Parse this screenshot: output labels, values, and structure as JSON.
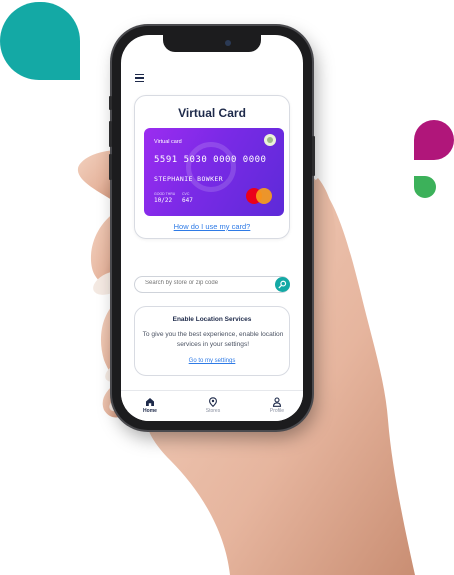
{
  "colors": {
    "teal": "#14a9a5",
    "magenta": "#b0167a",
    "green": "#3cb15a",
    "navy": "#1e2a4a",
    "link": "#2f7be6",
    "card_purple": "#7a2ae6"
  },
  "header": {
    "menu_icon": "hamburger-icon"
  },
  "virtual_card": {
    "title": "Virtual Card",
    "card_label": "Virtual card",
    "card_number": "5591 5030 0000 0000",
    "cardholder": "STEPHANIE BOWKER",
    "expiry_label": "GOOD THRU",
    "expiry": "10/22",
    "cvc_label": "CVC",
    "cvc": "647",
    "network_icon": "mastercard-icon",
    "help_link": "How do I use my card?"
  },
  "search": {
    "placeholder": "Search by store or zip code",
    "button_icon": "search-icon"
  },
  "location_services": {
    "title": "Enable Location Services",
    "body": "To give you the best experience, enable location services in your settings!",
    "link": "Go to my settings"
  },
  "nav": {
    "items": [
      {
        "label": "Home",
        "icon": "home-icon",
        "active": true
      },
      {
        "label": "Stores",
        "icon": "map-pin-icon",
        "active": false
      },
      {
        "label": "Profile",
        "icon": "user-icon",
        "active": false
      }
    ]
  }
}
